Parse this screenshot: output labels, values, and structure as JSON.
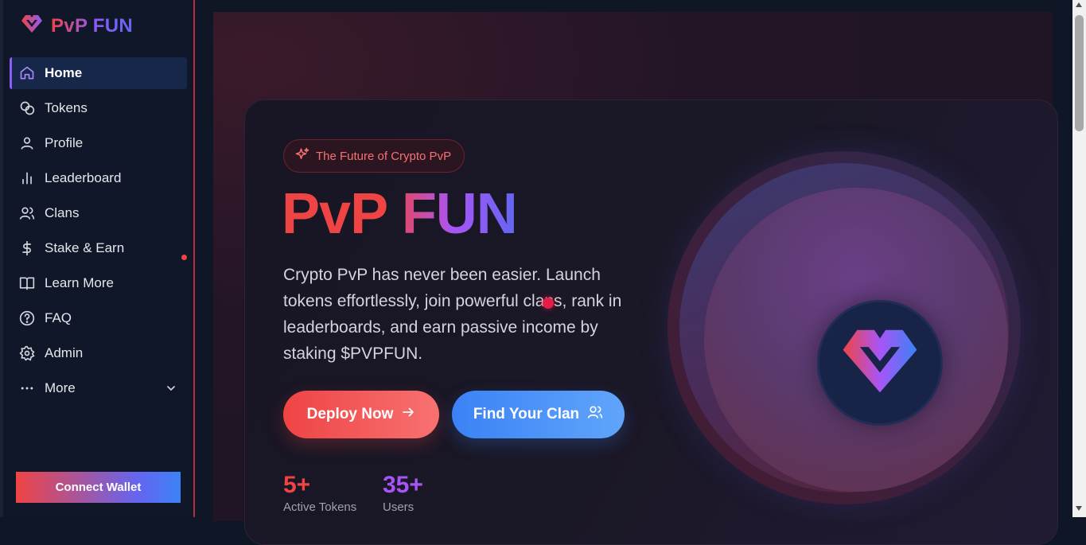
{
  "brand": {
    "name": "PvP FUN",
    "logo_icon": "pvp-heart-logo-icon"
  },
  "sidebar": {
    "items": [
      {
        "label": "Home",
        "icon": "home-icon",
        "active": true
      },
      {
        "label": "Tokens",
        "icon": "coins-icon"
      },
      {
        "label": "Profile",
        "icon": "user-icon"
      },
      {
        "label": "Leaderboard",
        "icon": "bar-chart-icon"
      },
      {
        "label": "Clans",
        "icon": "users-icon"
      },
      {
        "label": "Stake & Earn",
        "icon": "dollar-icon",
        "notification": true
      },
      {
        "label": "Learn More",
        "icon": "book-icon"
      },
      {
        "label": "FAQ",
        "icon": "help-circle-icon"
      },
      {
        "label": "Admin",
        "icon": "gear-icon"
      },
      {
        "label": "More",
        "icon": "more-dots-icon",
        "expandable": true
      }
    ],
    "connect_label": "Connect Wallet"
  },
  "hero": {
    "pill_label": "The Future of Crypto PvP",
    "title_part1": "PvP",
    "title_part2": "FUN",
    "description": "Crypto PvP has never been easier. Launch tokens effortlessly, join powerful clans, rank in leaderboards, and earn passive income by staking $PVPFUN.",
    "deploy_label": "Deploy Now",
    "clan_label": "Find Your Clan",
    "stats": [
      {
        "value": "5+",
        "label": "Active Tokens"
      },
      {
        "value": "35+",
        "label": "Users"
      }
    ]
  },
  "colors": {
    "accent_red": "#ef4444",
    "accent_purple": "#a855f7",
    "accent_blue": "#3b82f6",
    "sidebar_bg": "#0f1729"
  }
}
